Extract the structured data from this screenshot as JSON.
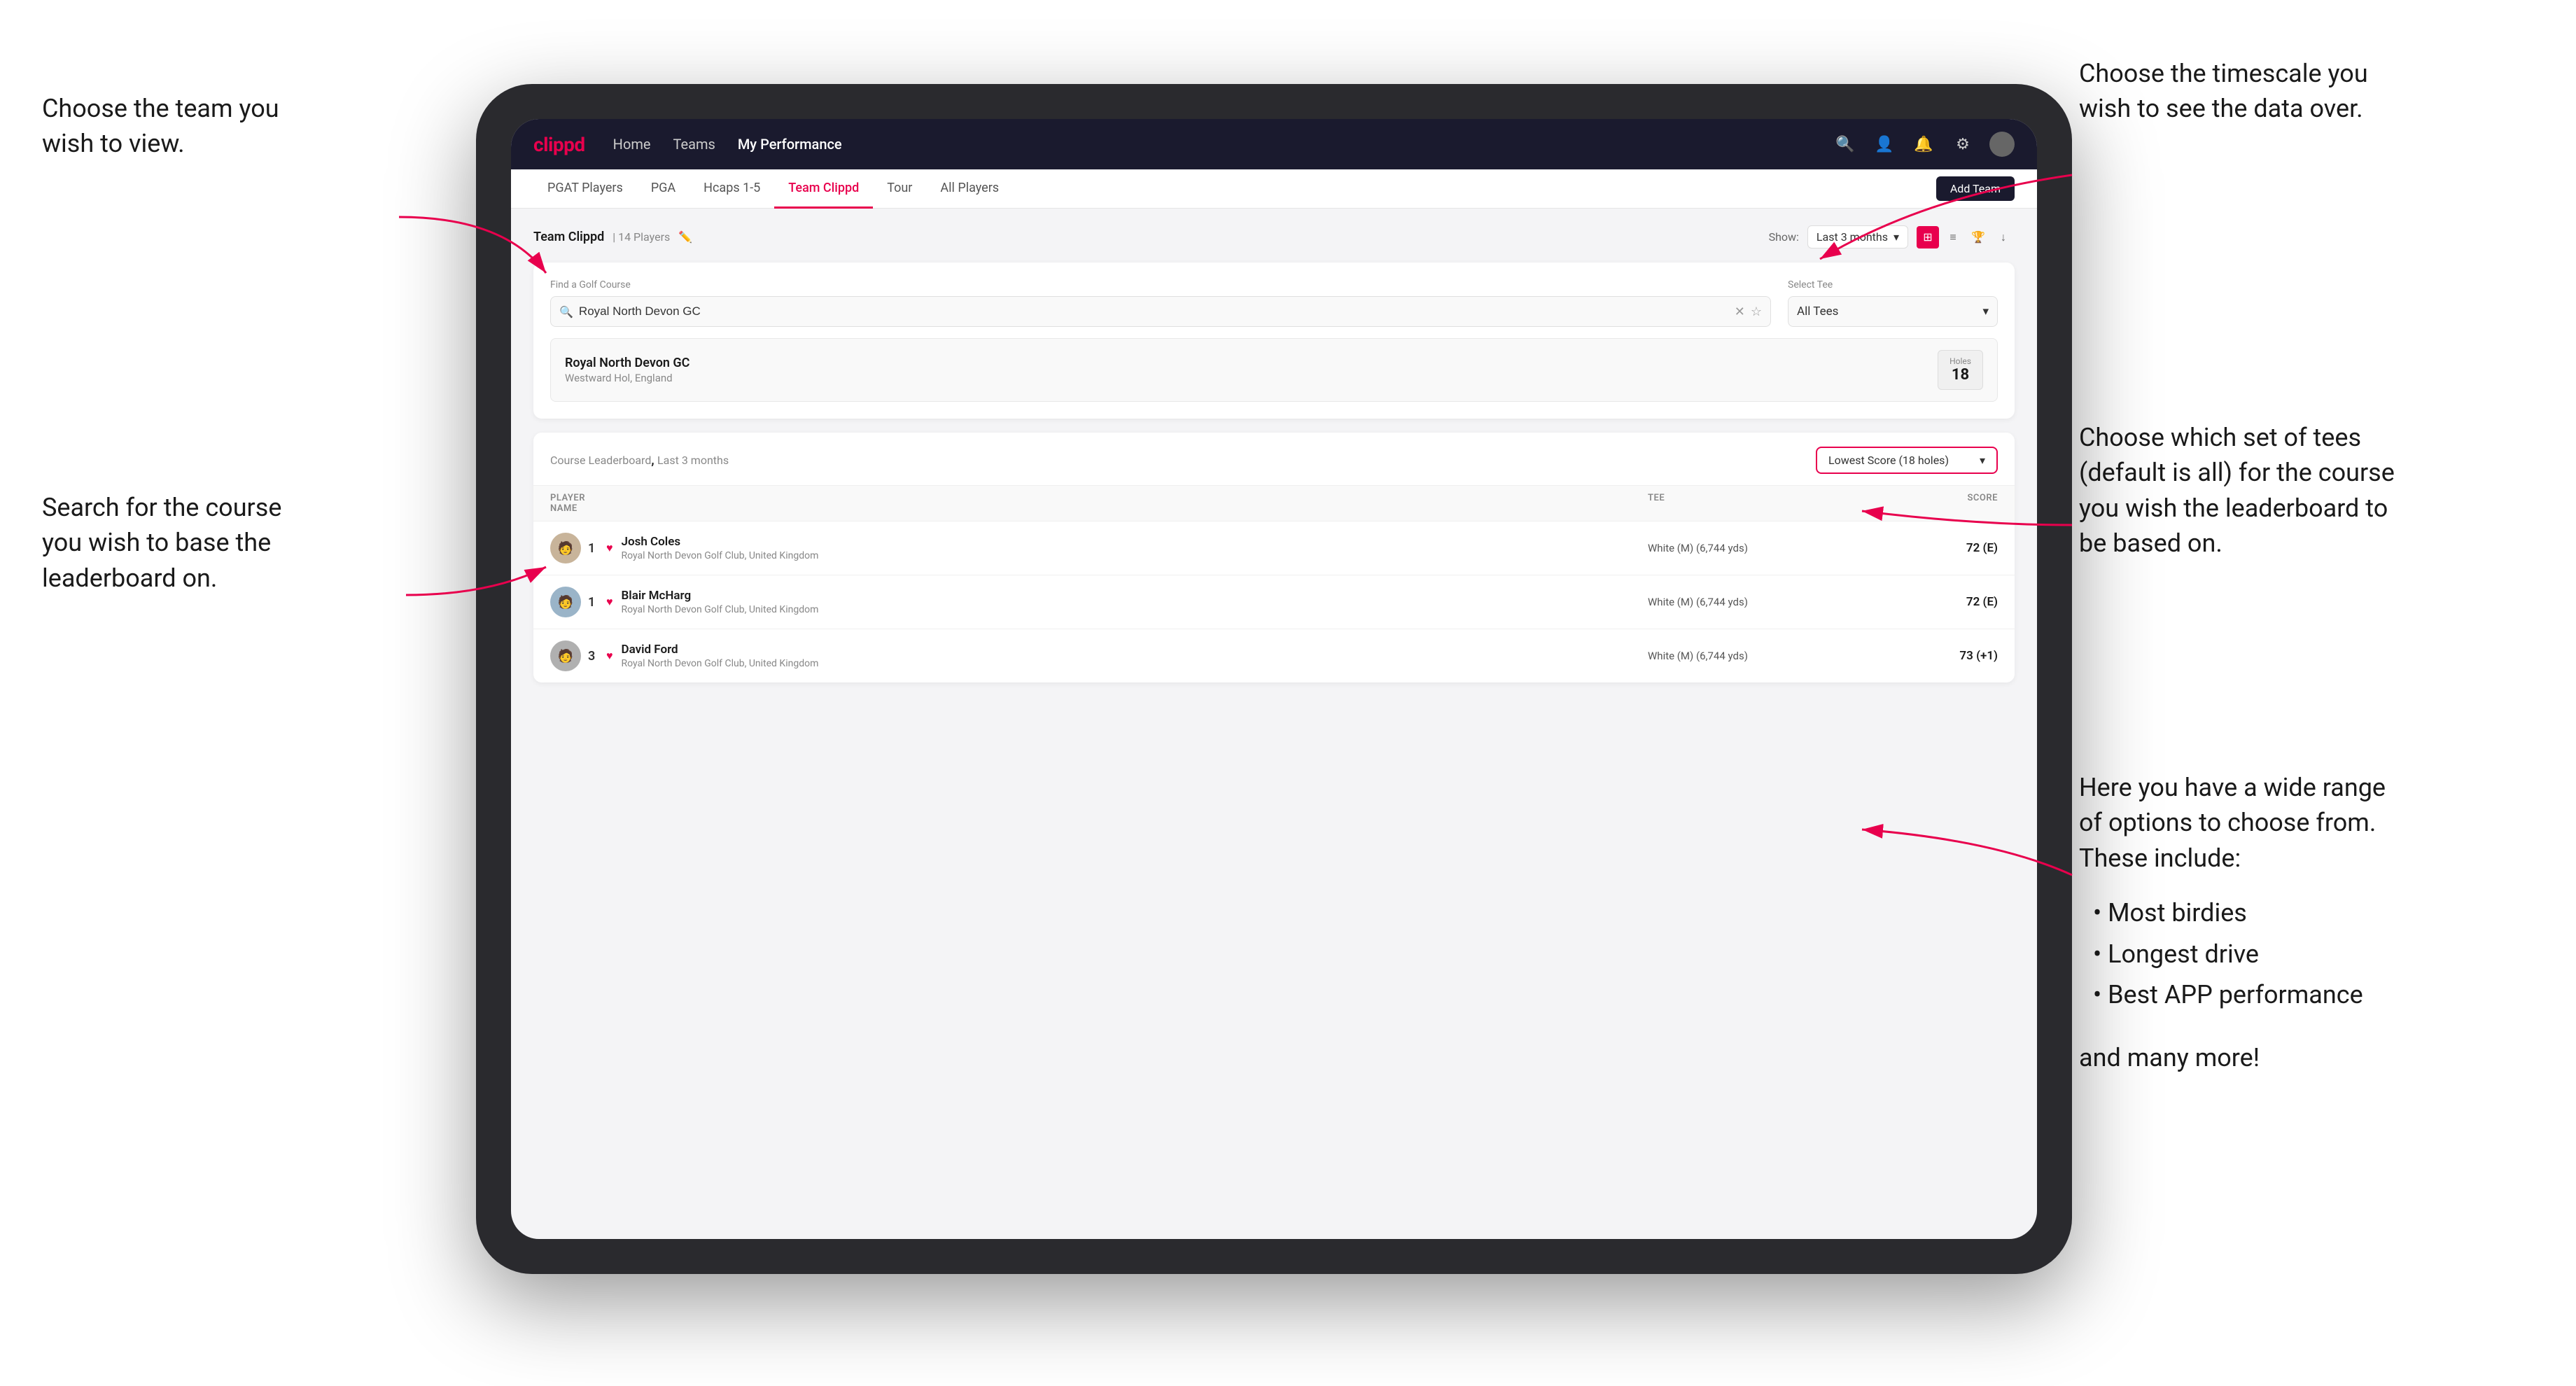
{
  "annotations": {
    "top_left": {
      "text": "Choose the team you\nwish to view."
    },
    "top_right": {
      "text": "Choose the timescale you\nwish to see the data over."
    },
    "mid_right": {
      "text": "Choose which set of tees\n(default is all) for the course\nyou wish the leaderboard to\nbe based on."
    },
    "mid_left": {
      "text": "Search for the course\nyou wish to base the\nleaderboard on."
    },
    "bottom_right_title": {
      "text": "Here you have a wide range\nof options to choose from.\nThese include:"
    },
    "bottom_right_bullets": {
      "items": [
        "Most birdies",
        "Longest drive",
        "Best APP performance"
      ]
    },
    "bottom_right_footer": {
      "text": "and many more!"
    }
  },
  "nav": {
    "logo": "clippd",
    "links": [
      "Home",
      "Teams",
      "My Performance"
    ],
    "active_link": "My Performance"
  },
  "sub_nav": {
    "tabs": [
      "PGAT Players",
      "PGA",
      "Hcaps 1-5",
      "Team Clippd",
      "Tour",
      "All Players"
    ],
    "active_tab": "Team Clippd",
    "add_team_label": "Add Team"
  },
  "team_header": {
    "title": "Team Clippd",
    "player_count": "14 Players",
    "show_label": "Show:",
    "time_period": "Last 3 months"
  },
  "search": {
    "find_label": "Find a Golf Course",
    "placeholder": "Royal North Devon GC",
    "tee_label": "Select Tee",
    "tee_value": "All Tees"
  },
  "course_result": {
    "name": "Royal North Devon GC",
    "location": "Westward Hol, England",
    "holes_label": "Holes",
    "holes_value": "18"
  },
  "leaderboard": {
    "title": "Course Leaderboard",
    "period": "Last 3 months",
    "score_type": "Lowest Score (18 holes)",
    "columns": {
      "player": "PLAYER NAME",
      "tee": "TEE",
      "score": "SCORE"
    },
    "players": [
      {
        "rank": "1",
        "name": "Josh Coles",
        "club": "Royal North Devon Golf Club, United Kingdom",
        "tee": "White (M) (6,744 yds)",
        "score": "72 (E)",
        "avatar_color": "#c0b0a0"
      },
      {
        "rank": "1",
        "name": "Blair McHarg",
        "club": "Royal North Devon Golf Club, United Kingdom",
        "tee": "White (M) (6,744 yds)",
        "score": "72 (E)",
        "avatar_color": "#a0b0c0"
      },
      {
        "rank": "3",
        "name": "David Ford",
        "club": "Royal North Devon Golf Club, United Kingdom",
        "tee": "White (M) (6,744 yds)",
        "score": "73 (+1)",
        "avatar_color": "#b0b0b0"
      }
    ]
  },
  "colors": {
    "brand_pink": "#e8004d",
    "nav_dark": "#1a1a2e",
    "text_dark": "#1a1a1a",
    "text_muted": "#888888"
  }
}
